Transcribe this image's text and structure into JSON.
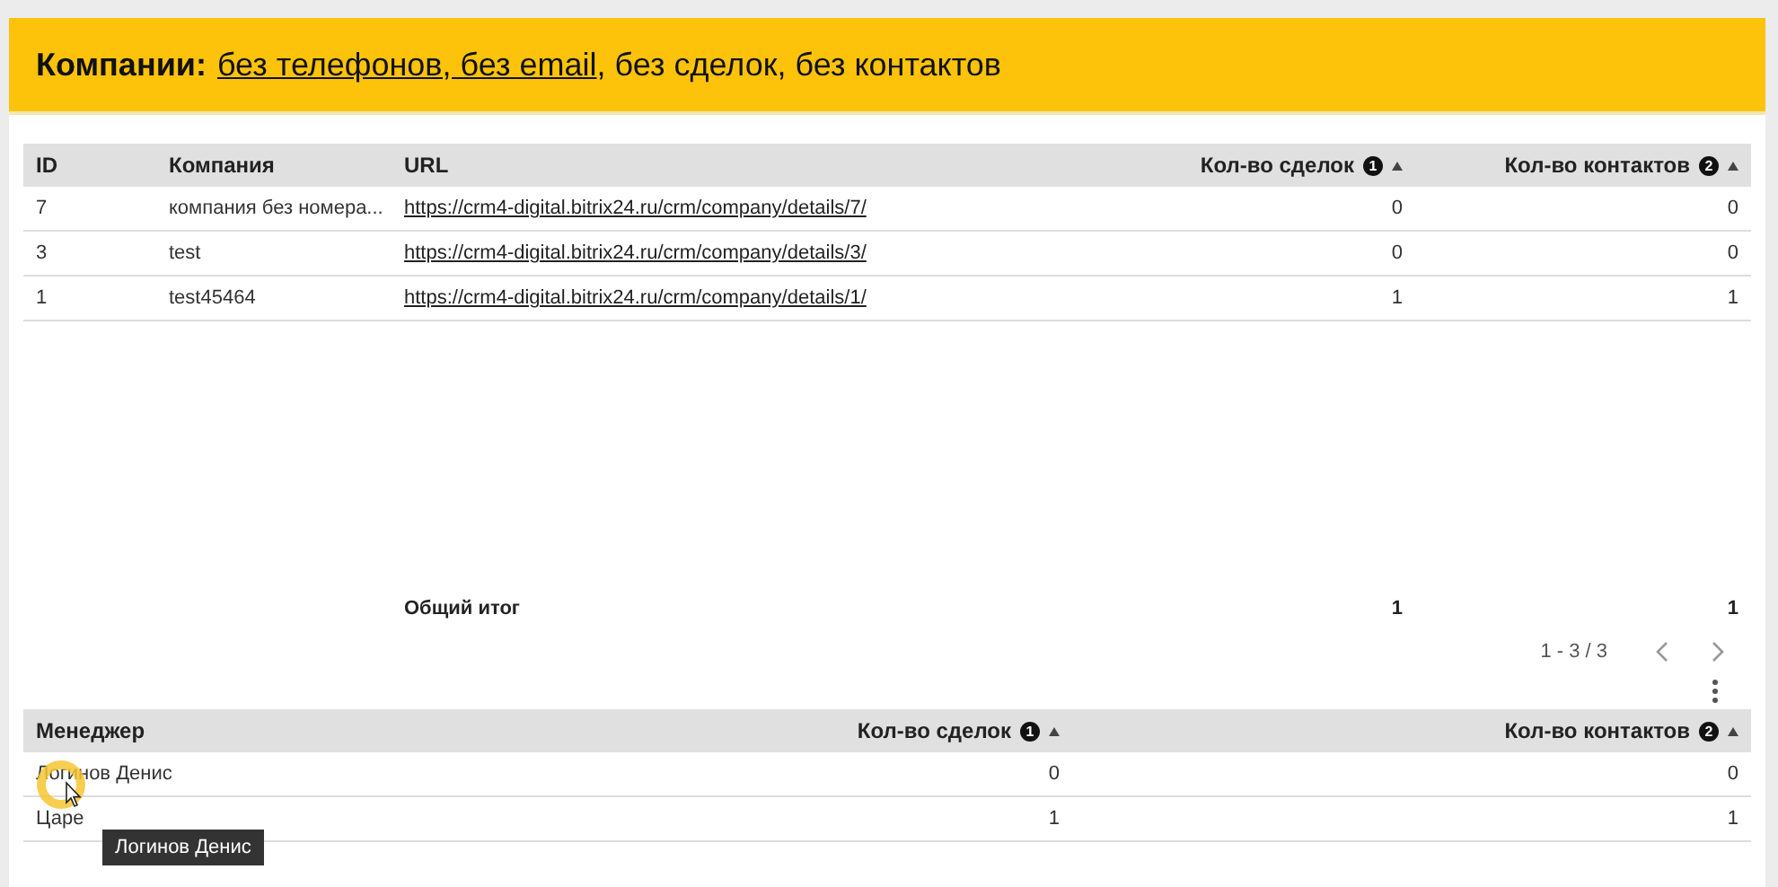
{
  "header": {
    "label": "Компании:",
    "link": "без телефонов, без email",
    "rest": ", без сделок, без контактов"
  },
  "companies_table": {
    "columns": [
      {
        "label": "ID"
      },
      {
        "label": "Компания"
      },
      {
        "label": "URL"
      },
      {
        "label": "Кол-во сделок",
        "badge": "1",
        "sortable": true
      },
      {
        "label": "Кол-во контактов",
        "badge": "2",
        "sortable": true
      }
    ],
    "rows": [
      {
        "cells": [
          "7",
          "компания без номера...",
          "https://crm4-digital.bitrix24.ru/crm/company/details/7/",
          "0",
          "0"
        ]
      },
      {
        "cells": [
          "3",
          "test",
          "https://crm4-digital.bitrix24.ru/crm/company/details/3/",
          "0",
          "0"
        ]
      },
      {
        "cells": [
          "1",
          "test45464",
          "https://crm4-digital.bitrix24.ru/crm/company/details/1/",
          "1",
          "1"
        ]
      }
    ],
    "total": {
      "label": "Общий итог",
      "values": [
        "1",
        "1"
      ]
    },
    "pagination": {
      "range": "1 - 3 / 3"
    }
  },
  "managers_table": {
    "columns": [
      {
        "label": "Менеджер"
      },
      {
        "label": "Кол-во сделок",
        "badge": "1",
        "sortable": true
      },
      {
        "label": "Кол-во контактов",
        "badge": "2",
        "sortable": true
      }
    ],
    "rows": [
      {
        "cells": [
          "Логинов Денис",
          "0",
          "0"
        ]
      },
      {
        "cells": [
          "Царе",
          "1",
          "1"
        ]
      }
    ]
  },
  "tooltip": {
    "text": "Логинов Денис"
  }
}
